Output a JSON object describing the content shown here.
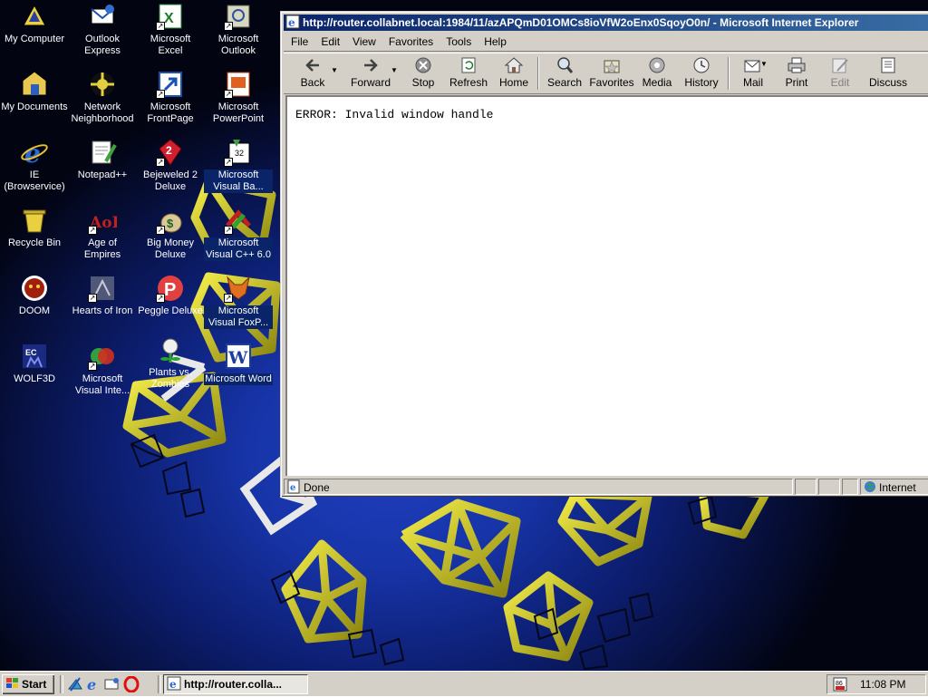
{
  "desktop": {
    "icons": [
      {
        "label": "My Computer",
        "icon": "my-computer-icon"
      },
      {
        "label": "Outlook Express",
        "icon": "outlook-express-icon"
      },
      {
        "label": "Microsoft Excel",
        "icon": "excel-icon"
      },
      {
        "label": "Microsoft Outlook",
        "icon": "outlook-icon"
      },
      {
        "label": "My Documents",
        "icon": "my-documents-icon"
      },
      {
        "label": "Network Neighborhood",
        "icon": "network-icon"
      },
      {
        "label": "Microsoft FrontPage",
        "icon": "frontpage-icon"
      },
      {
        "label": "Microsoft PowerPoint",
        "icon": "powerpoint-icon"
      },
      {
        "label": "IE (Browservice)",
        "icon": "ie-icon"
      },
      {
        "label": "Notepad++",
        "icon": "notepadpp-icon"
      },
      {
        "label": "Bejeweled 2 Deluxe",
        "icon": "bejeweled-icon"
      },
      {
        "label": "Microsoft Visual Ba...",
        "icon": "visual-basic-icon"
      },
      {
        "label": "Recycle Bin",
        "icon": "recycle-bin-icon"
      },
      {
        "label": "Age of Empires",
        "icon": "age-of-empires-icon"
      },
      {
        "label": "Big Money Deluxe",
        "icon": "big-money-icon"
      },
      {
        "label": "Microsoft Visual C++ 6.0",
        "icon": "visual-cpp-icon"
      },
      {
        "label": "DOOM",
        "icon": "doom-icon"
      },
      {
        "label": "Hearts of Iron",
        "icon": "hearts-of-iron-icon"
      },
      {
        "label": "Peggle Deluxe",
        "icon": "peggle-icon"
      },
      {
        "label": "Microsoft Visual FoxP...",
        "icon": "visual-foxpro-icon"
      },
      {
        "label": "WOLF3D",
        "icon": "wolf3d-icon"
      },
      {
        "label": "Microsoft Visual Inte...",
        "icon": "visual-interdev-icon"
      },
      {
        "label": "Plants vs. Zombies",
        "icon": "plants-vs-zombies-icon"
      },
      {
        "label": "Microsoft Word",
        "icon": "word-icon"
      }
    ]
  },
  "ie": {
    "title": "http://router.collabnet.local:1984/11/azAPQmD01OMCs8ioVfW2oEnx0SqoyO0n/ - Microsoft Internet Explorer",
    "menu": [
      "File",
      "Edit",
      "View",
      "Favorites",
      "Tools",
      "Help"
    ],
    "toolbar": {
      "back": "Back",
      "forward": "Forward",
      "stop": "Stop",
      "refresh": "Refresh",
      "home": "Home",
      "search": "Search",
      "favorites": "Favorites",
      "media": "Media",
      "history": "History",
      "mail": "Mail",
      "print": "Print",
      "edit": "Edit",
      "discuss": "Discuss"
    },
    "content_text": "ERROR: Invalid window handle",
    "status": {
      "text": "Done",
      "zone": "Internet"
    }
  },
  "taskbar": {
    "start_label": "Start",
    "task_label": "http://router.colla...",
    "clock": "11:08 PM"
  },
  "colors": {
    "titlebar_start": "#0a246a",
    "titlebar_end": "#3a6ea5",
    "chrome": "#d4d0c8",
    "wallpaper_blue": "#1734a8",
    "wireframe_yellow": "#d8d020"
  }
}
